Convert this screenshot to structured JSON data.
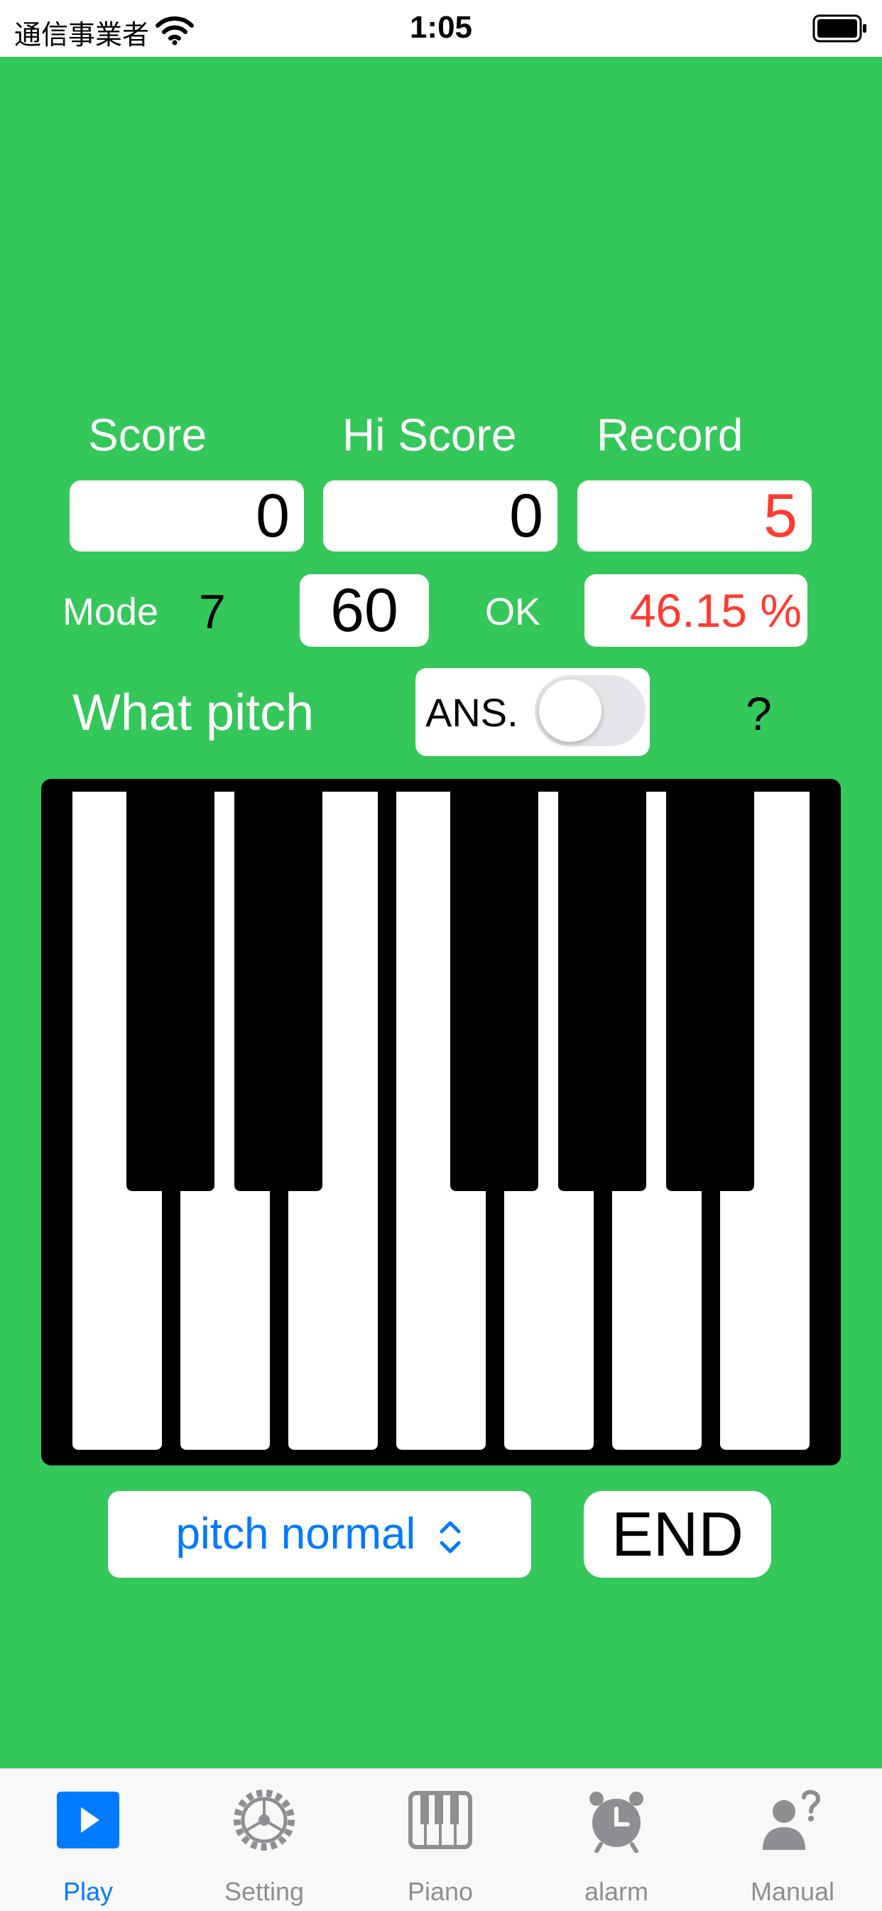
{
  "status_bar": {
    "carrier": "通信事業者",
    "time": "1:05"
  },
  "scoreboard": {
    "score_label": "Score",
    "hiscore_label": "Hi Score",
    "record_label": "Record",
    "score_value": "0",
    "hiscore_value": "0",
    "record_value": "5"
  },
  "stats": {
    "mode_label": "Mode",
    "mode_value": "7",
    "count_value": "60",
    "ok_label": "OK",
    "ok_percent": "46.15 %"
  },
  "question": {
    "title": "What pitch",
    "ans_label": "ANS.",
    "ans_toggle_on": false,
    "help_label": "?"
  },
  "piano": {
    "white_keys": 7,
    "black_keys": 5
  },
  "controls": {
    "pitch_select_value": "pitch normal",
    "end_label": "END"
  },
  "tab_bar": {
    "tabs": [
      {
        "label": "Play",
        "icon": "play-icon",
        "active": true
      },
      {
        "label": "Setting",
        "icon": "gear-icon",
        "active": false
      },
      {
        "label": "Piano",
        "icon": "piano-icon",
        "active": false
      },
      {
        "label": "alarm",
        "icon": "alarm-clock-icon",
        "active": false
      },
      {
        "label": "Manual",
        "icon": "person-question-icon",
        "active": false
      }
    ]
  },
  "colors": {
    "background": "#34C759",
    "accent": "#007AFF",
    "alert": "#FF3B30",
    "tab_inactive": "#8E8E93"
  }
}
